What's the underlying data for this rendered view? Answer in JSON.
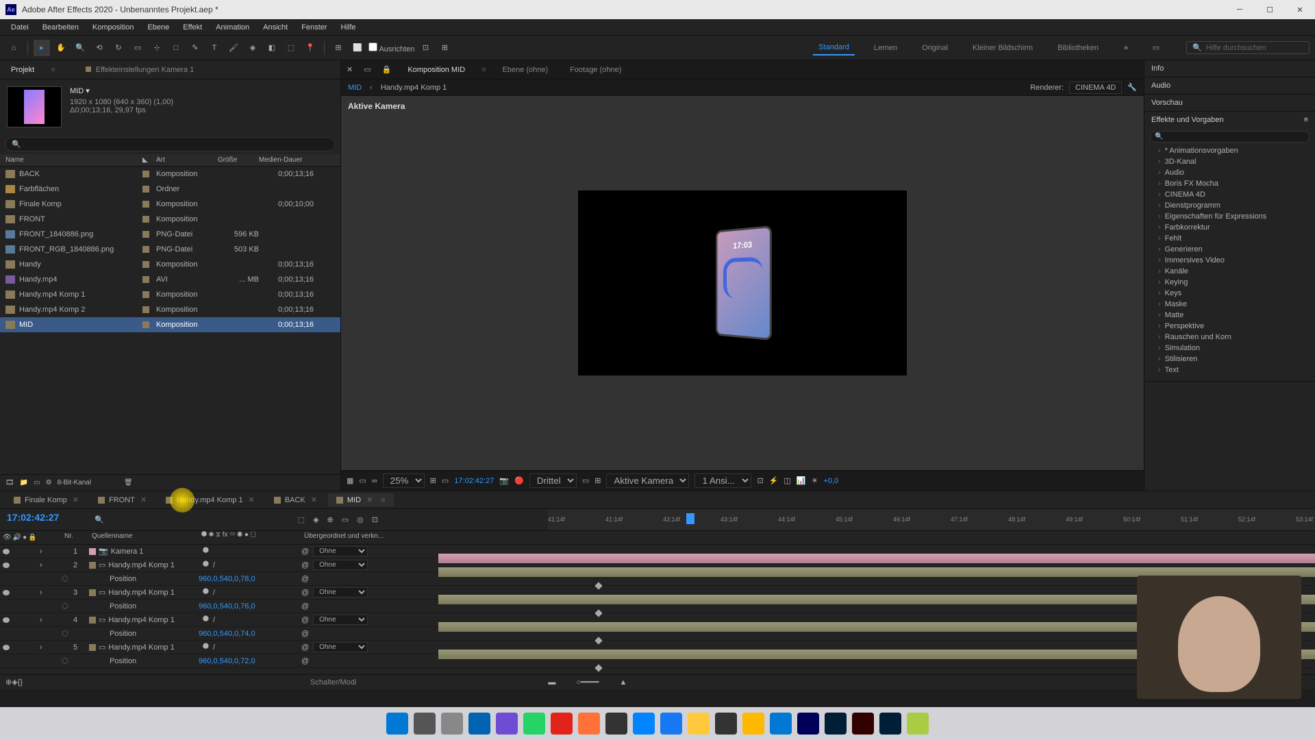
{
  "title": "Adobe After Effects 2020 - Unbenanntes Projekt.aep *",
  "menu": [
    "Datei",
    "Bearbeiten",
    "Komposition",
    "Ebene",
    "Effekt",
    "Animation",
    "Ansicht",
    "Fenster",
    "Hilfe"
  ],
  "toolbar": {
    "align": "Ausrichten",
    "workspaces": [
      "Standard",
      "Lernen",
      "Original",
      "Kleiner Bildschirm",
      "Bibliotheken"
    ],
    "active_workspace": "Standard",
    "search_placeholder": "Hilfe durchsuchen"
  },
  "project": {
    "tab": "Projekt",
    "effects_tab": "Effekteinstellungen Kamera 1",
    "comp_name": "MID ▾",
    "comp_dims": "1920 x 1080 (640 x 360) (1,00)",
    "comp_dur": "Δ0;00;13;16, 29,97 fps",
    "headers": {
      "name": "Name",
      "art": "Art",
      "size": "Größe",
      "dur": "Medien-Dauer"
    },
    "footer": "8-Bit-Kanal",
    "items": [
      {
        "name": "BACK",
        "icon": "comp",
        "art": "Komposition",
        "size": "",
        "dur": "0;00;13;16"
      },
      {
        "name": "Farbflächen",
        "icon": "folder",
        "art": "Ordner",
        "size": "",
        "dur": ""
      },
      {
        "name": "Finale Komp",
        "icon": "comp",
        "art": "Komposition",
        "size": "",
        "dur": "0;00;10;00"
      },
      {
        "name": "FRONT",
        "icon": "comp",
        "art": "Komposition",
        "size": "",
        "dur": ""
      },
      {
        "name": "FRONT_1840886.png",
        "icon": "png",
        "art": "PNG-Datei",
        "size": "596 KB",
        "dur": ""
      },
      {
        "name": "FRONT_RGB_1840886.png",
        "icon": "png",
        "art": "PNG-Datei",
        "size": "503 KB",
        "dur": ""
      },
      {
        "name": "Handy",
        "icon": "comp",
        "art": "Komposition",
        "size": "",
        "dur": "0;00;13;16"
      },
      {
        "name": "Handy.mp4",
        "icon": "avi",
        "art": "AVI",
        "size": "... MB",
        "dur": "0;00;13;16"
      },
      {
        "name": "Handy.mp4 Komp 1",
        "icon": "comp",
        "art": "Komposition",
        "size": "",
        "dur": "0;00;13;16"
      },
      {
        "name": "Handy.mp4 Komp 2",
        "icon": "comp",
        "art": "Komposition",
        "size": "",
        "dur": "0;00;13;16"
      },
      {
        "name": "MID",
        "icon": "comp",
        "art": "Komposition",
        "size": "",
        "dur": "0;00;13;16",
        "selected": true
      }
    ]
  },
  "viewer": {
    "tabs": {
      "comp": "Komposition MID",
      "layer": "Ebene (ohne)",
      "footage": "Footage (ohne)"
    },
    "crumb_active": "MID",
    "crumb_next": "Handy.mp4 Komp 1",
    "renderer_label": "Renderer:",
    "renderer_value": "CINEMA 4D",
    "label": "Aktive Kamera",
    "phone_time": "17:03",
    "controls": {
      "zoom": "25%",
      "timecode": "17:02:42:27",
      "quality": "Drittel",
      "camera": "Aktive Kamera",
      "views": "1 Ansi...",
      "exposure": "+0,0"
    }
  },
  "right": {
    "sections": [
      "Info",
      "Audio",
      "Vorschau"
    ],
    "effects_title": "Effekte und Vorgaben",
    "effects": [
      "* Animationsvorgaben",
      "3D-Kanal",
      "Audio",
      "Boris FX Mocha",
      "CINEMA 4D",
      "Dienstprogramm",
      "Eigenschaften für Expressions",
      "Farbkorrektur",
      "Fehlt",
      "Generieren",
      "Immersives Video",
      "Kanäle",
      "Keying",
      "Keys",
      "Maske",
      "Matte",
      "Perspektive",
      "Rauschen und Korn",
      "Simulation",
      "Stilisieren",
      "Text"
    ]
  },
  "timeline": {
    "tabs": [
      {
        "label": "Finale Komp",
        "close": true
      },
      {
        "label": "FRONT",
        "close": true
      },
      {
        "label": "Handy.mp4 Komp 1",
        "close": true
      },
      {
        "label": "BACK",
        "close": true
      },
      {
        "label": "MID",
        "close": true,
        "active": true
      }
    ],
    "timecode": "17:02:42:27",
    "cols": {
      "nr": "Nr.",
      "name": "Quellenname",
      "parent": "Übergeordnet und verkn..."
    },
    "ticks": [
      "41:14f",
      "41:14f",
      "42:14f",
      "43:14f",
      "44:14f",
      "45:14f",
      "46:14f",
      "47:14f",
      "48:14f",
      "49:14f",
      "50:14f",
      "51:14f",
      "52:14f",
      "53:14f"
    ],
    "parent_none": "Ohne",
    "footer": "Schalter/Modi",
    "layers": [
      {
        "nr": "1",
        "name": "Kamera 1",
        "type": "cam"
      },
      {
        "nr": "2",
        "name": "Handy.mp4 Komp 1",
        "type": "vid",
        "pos": "960,0,540,0,78,0"
      },
      {
        "nr": "3",
        "name": "Handy.mp4 Komp 1",
        "type": "vid",
        "pos": "960,0,540,0,76,0"
      },
      {
        "nr": "4",
        "name": "Handy.mp4 Komp 1",
        "type": "vid",
        "pos": "960,0,540,0,74,0"
      },
      {
        "nr": "5",
        "name": "Handy.mp4 Komp 1",
        "type": "vid",
        "pos": "960,0,540,0,72,0"
      }
    ],
    "position_label": "Position"
  },
  "taskbar": {
    "colors": [
      "#0078d4",
      "#555",
      "#888",
      "#0063b1",
      "#6e4dd4",
      "#25d366",
      "#e2231a",
      "#ff7139",
      "#333",
      "#0084ff",
      "#1877f2",
      "#ffc83d",
      "#333",
      "#ffb900",
      "#0078d4",
      "#00005b",
      "#001e36",
      "#330000",
      "#001e36",
      "#aacc44"
    ]
  }
}
